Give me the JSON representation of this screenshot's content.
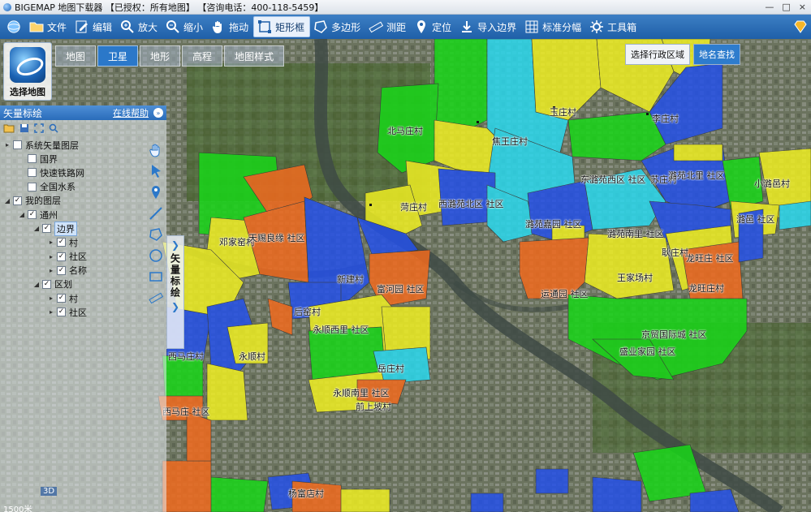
{
  "window": {
    "title": "BIGEMAP 地图下载器 【已授权：所有地图】  【咨询电话：400-118-5459】",
    "controls": [
      "—",
      "□",
      "×"
    ]
  },
  "toolbar": {
    "items": [
      {
        "label": "",
        "icon": "globe-icon"
      },
      {
        "label": "文件",
        "icon": "folder-icon"
      },
      {
        "label": "编辑",
        "icon": "edit-icon"
      },
      {
        "label": "放大",
        "icon": "zoom-in-icon"
      },
      {
        "label": "缩小",
        "icon": "zoom-out-icon"
      },
      {
        "label": "拖动",
        "icon": "hand-icon"
      },
      {
        "label": "矩形框",
        "icon": "rectangle-select-icon",
        "active": true
      },
      {
        "label": "多边形",
        "icon": "polygon-icon"
      },
      {
        "label": "测距",
        "icon": "ruler-icon"
      },
      {
        "label": "定位",
        "icon": "location-icon"
      },
      {
        "label": "导入边界",
        "icon": "import-arrow-icon"
      },
      {
        "label": "标准分幅",
        "icon": "grid-icon"
      },
      {
        "label": "工具箱",
        "icon": "toolbox-icon"
      }
    ]
  },
  "map_type": {
    "select_label": "选择地图",
    "tabs": [
      {
        "label": "地图",
        "active": false
      },
      {
        "label": "卫星",
        "active": true
      },
      {
        "label": "地形",
        "active": false
      },
      {
        "label": "高程",
        "active": false
      },
      {
        "label": "地图样式",
        "active": false
      }
    ]
  },
  "right_tabs": {
    "region": "选择行政区域",
    "place_search": "地名查找"
  },
  "panel": {
    "title": "矢量标绘",
    "help": "在线帮助",
    "tree": [
      {
        "label": "系统矢量图层",
        "level": 0,
        "expand": "▸",
        "checked": false
      },
      {
        "label": "国界",
        "level": 1,
        "expand": "",
        "checked": false
      },
      {
        "label": "快速铁路网",
        "level": 1,
        "expand": "",
        "checked": false
      },
      {
        "label": "全国水系",
        "level": 1,
        "expand": "",
        "checked": false
      },
      {
        "label": "我的图层",
        "level": 0,
        "expand": "◢",
        "checked": true
      },
      {
        "label": "通州",
        "level": 1,
        "expand": "◢",
        "checked": true
      },
      {
        "label": "边界",
        "level": 2,
        "expand": "◢",
        "checked": true,
        "selected": true
      },
      {
        "label": "村",
        "level": 3,
        "expand": "▸",
        "checked": true
      },
      {
        "label": "社区",
        "level": 3,
        "expand": "▸",
        "checked": true
      },
      {
        "label": "名称",
        "level": 3,
        "expand": "▸",
        "checked": true
      },
      {
        "label": "区划",
        "level": 2,
        "expand": "◢",
        "checked": true
      },
      {
        "label": "村",
        "level": 3,
        "expand": "▸",
        "checked": true
      },
      {
        "label": "社区",
        "level": 3,
        "expand": "▸",
        "checked": true
      }
    ],
    "side_label": "矢量标绘",
    "scale_text": "1500米",
    "badge_3d": "3D"
  },
  "map_labels": [
    {
      "text": "北马庄村"
    },
    {
      "text": "焦王庄村"
    },
    {
      "text": "玉庄村"
    },
    {
      "text": "李庄村"
    },
    {
      "text": "东潞苑西区 社区"
    },
    {
      "text": "苏庄村"
    },
    {
      "text": "潞苑北里 社区"
    },
    {
      "text": "小潞邑村"
    },
    {
      "text": "菏庄村"
    },
    {
      "text": "西潞苑北区 社区"
    },
    {
      "text": "潞苑嘉园 社区"
    },
    {
      "text": "潞邑 社区"
    },
    {
      "text": "潞苑南里 社区"
    },
    {
      "text": "邓家窑村"
    },
    {
      "text": "天赐良缘 社区"
    },
    {
      "text": "耿庄村"
    },
    {
      "text": "龙旺庄 社区"
    },
    {
      "text": "王家场村"
    },
    {
      "text": "新建村"
    },
    {
      "text": "富河园 社区"
    },
    {
      "text": "龙旺庄村"
    },
    {
      "text": "运通园 社区"
    },
    {
      "text": "后窑村"
    },
    {
      "text": "永顺西里 社区"
    },
    {
      "text": "京贸国际城 社区"
    },
    {
      "text": "西马庄村"
    },
    {
      "text": "永顺村"
    },
    {
      "text": "盛业家园 社区"
    },
    {
      "text": "岳庄村"
    },
    {
      "text": "永顺南里 社区"
    },
    {
      "text": "西马庄 社区"
    },
    {
      "text": "前上坡村"
    },
    {
      "text": "杨富店村"
    }
  ],
  "colors": {
    "green": "#18d618",
    "yellow": "#eeee22",
    "blue": "#2450e8",
    "cyan": "#2ad8ee",
    "orange": "#f06a1e"
  }
}
